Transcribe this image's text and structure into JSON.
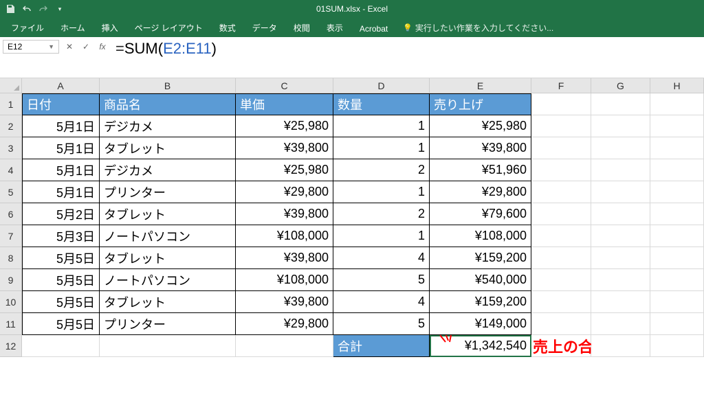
{
  "title": "01SUM.xlsx - Excel",
  "ribbon": {
    "tabs": [
      "ファイル",
      "ホーム",
      "挿入",
      "ページ レイアウト",
      "数式",
      "データ",
      "校閲",
      "表示",
      "Acrobat"
    ],
    "tell_me": "実行したい作業を入力してください..."
  },
  "name_box": "E12",
  "formula": {
    "raw": "=SUM(E2:E11)",
    "eq": "=",
    "fn": "SUM",
    "open": "(",
    "ref": "E2:E11",
    "close": ")"
  },
  "columns": [
    "A",
    "B",
    "C",
    "D",
    "E",
    "F",
    "G",
    "H"
  ],
  "row_headers": [
    "1",
    "2",
    "3",
    "4",
    "5",
    "6",
    "7",
    "8",
    "9",
    "10",
    "11",
    "12"
  ],
  "headers": {
    "A": "日付",
    "B": "商品名",
    "C": "単価",
    "D": "数量",
    "E": "売り上げ"
  },
  "data": [
    {
      "A": "5月1日",
      "B": "デジカメ",
      "C": "¥25,980",
      "D": "1",
      "E": "¥25,980"
    },
    {
      "A": "5月1日",
      "B": "タブレット",
      "C": "¥39,800",
      "D": "1",
      "E": "¥39,800"
    },
    {
      "A": "5月1日",
      "B": "デジカメ",
      "C": "¥25,980",
      "D": "2",
      "E": "¥51,960"
    },
    {
      "A": "5月1日",
      "B": "プリンター",
      "C": "¥29,800",
      "D": "1",
      "E": "¥29,800"
    },
    {
      "A": "5月2日",
      "B": "タブレット",
      "C": "¥39,800",
      "D": "2",
      "E": "¥79,600"
    },
    {
      "A": "5月3日",
      "B": "ノートパソコン",
      "C": "¥108,000",
      "D": "1",
      "E": "¥108,000"
    },
    {
      "A": "5月5日",
      "B": "タブレット",
      "C": "¥39,800",
      "D": "4",
      "E": "¥159,200"
    },
    {
      "A": "5月5日",
      "B": "ノートパソコン",
      "C": "¥108,000",
      "D": "5",
      "E": "¥540,000"
    },
    {
      "A": "5月5日",
      "B": "タブレット",
      "C": "¥39,800",
      "D": "4",
      "E": "¥159,200"
    },
    {
      "A": "5月5日",
      "B": "プリンター",
      "C": "¥29,800",
      "D": "5",
      "E": "¥149,000"
    }
  ],
  "total_row": {
    "label": "合計",
    "value": "¥1,342,540"
  },
  "annotation": "売上の合計！"
}
